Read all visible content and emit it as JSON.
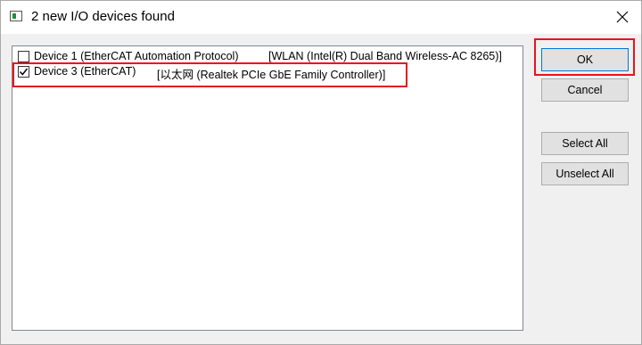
{
  "window": {
    "title": "2 new I/O devices found"
  },
  "devices": [
    {
      "name": "Device 1 (EtherCAT Automation Protocol)",
      "adapter": "[WLAN (Intel(R) Dual Band Wireless-AC 8265)]",
      "checked": false
    },
    {
      "name": "Device 3 (EtherCAT)",
      "adapter": "[以太网 (Realtek PCIe GbE Family Controller)]",
      "checked": true
    }
  ],
  "buttons": {
    "ok": "OK",
    "cancel": "Cancel",
    "select_all": "Select All",
    "unselect_all": "Unselect All"
  },
  "colors": {
    "highlight": "#e8141c",
    "default_button_border": "#0078d7"
  }
}
